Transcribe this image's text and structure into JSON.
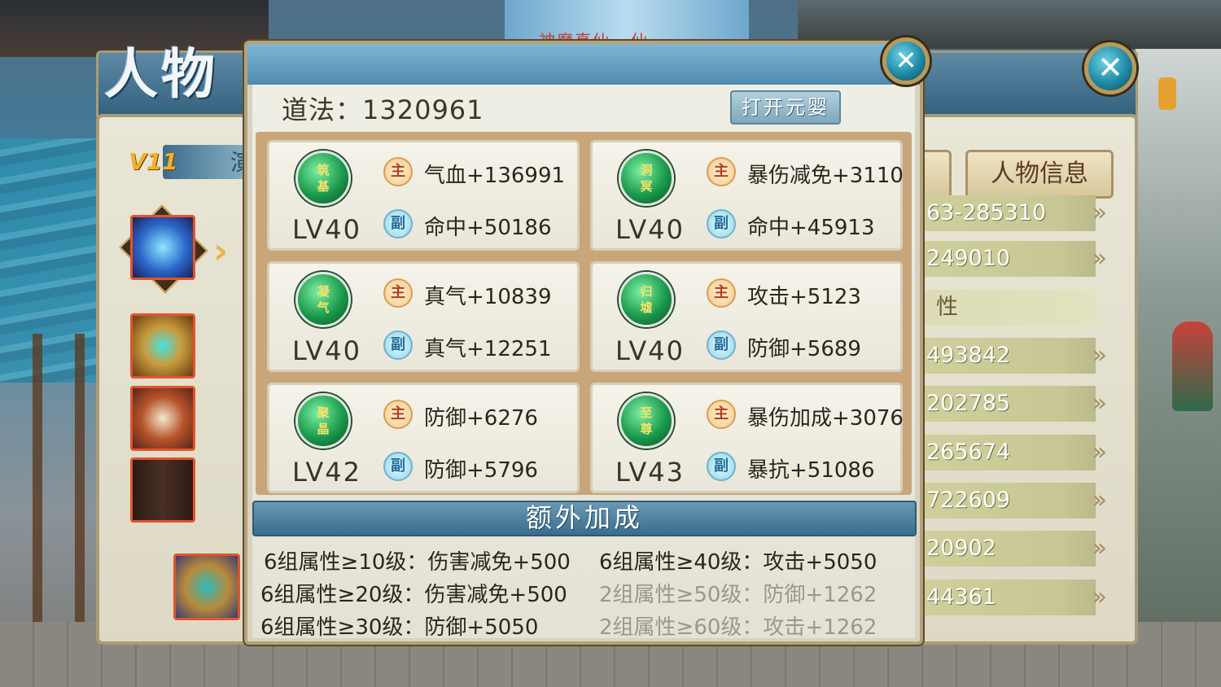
{
  "background_panel": {
    "title": "人物",
    "vip": "V11",
    "vip_fragment": "演",
    "tab_info_label": "人物信息",
    "stat_rows": [
      "63-285310",
      "249010",
      "性",
      "493842",
      "202785",
      "265674",
      "722609",
      "20902",
      "44361"
    ]
  },
  "scene": {
    "ghost_title": "神魔真仙 · 仙"
  },
  "popup": {
    "daofa_label": "道法：1320961",
    "open_button": "打开元婴",
    "close_symbol": "✕",
    "main_tag": "主",
    "sub_tag": "副",
    "cards": [
      {
        "orb": "筑基",
        "level": "LV40",
        "main": "气血+136991",
        "sub": "命中+50186"
      },
      {
        "orb": "洞冥",
        "level": "LV40",
        "main": "暴伤减免+3110",
        "sub": "命中+45913"
      },
      {
        "orb": "凝气",
        "level": "LV40",
        "main": "真气+10839",
        "sub": "真气+12251"
      },
      {
        "orb": "归墟",
        "level": "LV40",
        "main": "攻击+5123",
        "sub": "防御+5689"
      },
      {
        "orb": "聚晶",
        "level": "LV42",
        "main": "防御+6276",
        "sub": "防御+5796"
      },
      {
        "orb": "至尊",
        "level": "LV43",
        "main": "暴伤加成+3076",
        "sub": "暴抗+51086"
      }
    ],
    "extra_title": "额外加成",
    "bonuses": [
      {
        "text": "6组属性≥10级：伤害减免+500",
        "active": true
      },
      {
        "text": "6组属性≥40级：攻击+5050",
        "active": true
      },
      {
        "text": "6组属性≥20级：伤害减免+500",
        "active": true
      },
      {
        "text": "2组属性≥50级：防御+1262",
        "active": false
      },
      {
        "text": "6组属性≥30级：防御+5050",
        "active": true
      },
      {
        "text": "2组属性≥60级：攻击+1262",
        "active": false
      }
    ]
  },
  "colors": {
    "accent_blue": "#4e8bb0",
    "orb_green": "#1b9a4d",
    "main_tag": "#b23d1c",
    "sub_tag": "#1f6e9b",
    "inactive_text": "#9c978a"
  }
}
